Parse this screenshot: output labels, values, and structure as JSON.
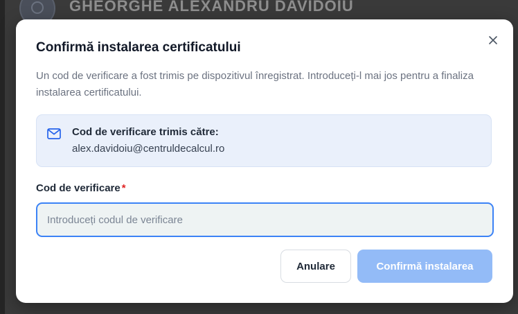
{
  "background": {
    "user_name": "GHEORGHE ALEXANDRU DAVIDOIU"
  },
  "dialog": {
    "title": "Confirmă instalarea certificatului",
    "description": "Un cod de verificare a fost trimis pe dispozitivul înregistrat. Introduceți-l mai jos pentru a finaliza instalarea certificatului.",
    "close_icon": "close-icon",
    "info": {
      "icon": "mail-icon",
      "title": "Cod de verificare trimis către:",
      "email": "alex.davidoiu@centruldecalcul.ro"
    },
    "field": {
      "label": "Cod de verificare",
      "required_marker": "*",
      "value": "",
      "placeholder": "Introduceți codul de verificare"
    },
    "buttons": {
      "cancel_label": "Anulare",
      "confirm_label": "Confirmă instalarea",
      "confirm_disabled": true
    },
    "colors": {
      "accent": "#3b82f6",
      "confirm_disabled_bg": "#93bbf7",
      "required": "#e02424",
      "info_bg": "#eaf0fb"
    }
  }
}
